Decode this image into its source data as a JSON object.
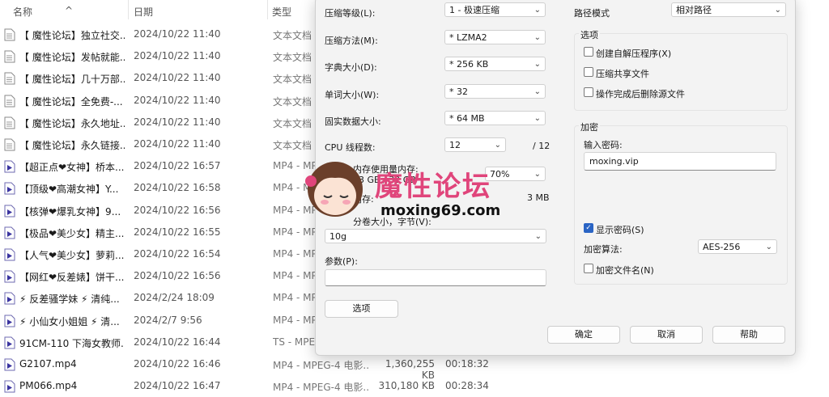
{
  "explorer": {
    "columns": {
      "name": "名称",
      "date": "日期",
      "type": "类型"
    },
    "rows": [
      {
        "icon": "text-file-icon",
        "name": "【 魔性论坛】独立社交...",
        "date": "2024/10/22 11:40",
        "type": "文本文档",
        "size": "",
        "duration": ""
      },
      {
        "icon": "text-file-icon",
        "name": "【 魔性论坛】发帖就能...",
        "date": "2024/10/22 11:40",
        "type": "文本文档",
        "size": "",
        "duration": ""
      },
      {
        "icon": "text-file-icon",
        "name": "【 魔性论坛】几十万部...",
        "date": "2024/10/22 11:40",
        "type": "文本文档",
        "size": "",
        "duration": ""
      },
      {
        "icon": "text-file-icon",
        "name": "【 魔性论坛】全免费-...",
        "date": "2024/10/22 11:40",
        "type": "文本文档",
        "size": "",
        "duration": ""
      },
      {
        "icon": "text-file-icon",
        "name": "【 魔性论坛】永久地址...",
        "date": "2024/10/22 11:40",
        "type": "文本文档",
        "size": "",
        "duration": ""
      },
      {
        "icon": "text-file-icon",
        "name": "【 魔性论坛】永久链接...",
        "date": "2024/10/22 11:40",
        "type": "文本文档",
        "size": "",
        "duration": ""
      },
      {
        "icon": "video-file-icon",
        "name": "【超正点❤女神】桥本...",
        "date": "2024/10/22 16:57",
        "type": "MP4 - MPEG",
        "size": "",
        "duration": ""
      },
      {
        "icon": "video-file-icon",
        "name": "【顶级❤高潮女神】Y...",
        "date": "2024/10/22 16:58",
        "type": "MP4 - MPEG",
        "size": "",
        "duration": ""
      },
      {
        "icon": "video-file-icon",
        "name": "【核弹❤爆乳女神】9...",
        "date": "2024/10/22 16:56",
        "type": "MP4 - MPEG",
        "size": "",
        "duration": ""
      },
      {
        "icon": "video-file-icon",
        "name": "【极品❤美少女】精主...",
        "date": "2024/10/22 16:55",
        "type": "MP4 - MPEG",
        "size": "",
        "duration": ""
      },
      {
        "icon": "video-file-icon",
        "name": "【人气❤美少女】萝莉...",
        "date": "2024/10/22 16:54",
        "type": "MP4 - MPEG",
        "size": "",
        "duration": ""
      },
      {
        "icon": "video-file-icon",
        "name": "【网红❤反差婊】饼干...",
        "date": "2024/10/22 16:56",
        "type": "MP4 - MPEG",
        "size": "",
        "duration": ""
      },
      {
        "icon": "video-file-icon",
        "name": "⚡ 反差骚学妹 ⚡ 清纯...",
        "date": "2024/2/24 18:09",
        "type": "MP4 - MPEG",
        "size": "",
        "duration": ""
      },
      {
        "icon": "video-file-icon",
        "name": "⚡ 小仙女小姐姐 ⚡ 清...",
        "date": "2024/2/7 9:56",
        "type": "MP4 - MPEG",
        "size": "",
        "duration": ""
      },
      {
        "icon": "video-file-icon",
        "name": "91CM-110 下海女教师...",
        "date": "2024/10/22 16:44",
        "type": "TS - MPEG",
        "size": "",
        "duration": ""
      },
      {
        "icon": "video-file-icon",
        "name": "G2107.mp4",
        "date": "2024/10/22 16:46",
        "type": "MP4 - MPEG-4 电影...",
        "size": "1,360,255 KB",
        "duration": "00:18:32"
      },
      {
        "icon": "video-file-icon",
        "name": "PM066.mp4",
        "date": "2024/10/22 16:47",
        "type": "MP4 - MPEG-4 电影...",
        "size": "310,180 KB",
        "duration": "00:28:34"
      }
    ]
  },
  "dialog": {
    "compression_level": {
      "label": "压缩等级(L):",
      "value": "1 - 极速压缩"
    },
    "compression_method": {
      "label": "压缩方法(M):",
      "value": "* LZMA2"
    },
    "dictionary_size": {
      "label": "字典大小(D):",
      "value": "* 256 KB"
    },
    "word_size": {
      "label": "单词大小(W):",
      "value": "* 32"
    },
    "solid_block_size": {
      "label": "固实数据大小:",
      "value": "* 64 MB"
    },
    "cpu_threads": {
      "label": "CPU 线程数:",
      "value": "12",
      "max": "/ 12"
    },
    "memory_usage": {
      "label_line1": "内存使用量内存:",
      "label_line2": "23 GB",
      "label_line3": "/ 32 GB",
      "value": "70%"
    },
    "decompress_memory": {
      "label": "内存:",
      "value": "3 MB"
    },
    "volume_size": {
      "label": "分卷大小，字节(V):",
      "value": "10g"
    },
    "parameters": {
      "label": "参数(P):",
      "value": ""
    },
    "options_button": "选项",
    "path_mode": {
      "label": "路径模式",
      "value": "相对路径"
    },
    "options_group": {
      "title": "选项",
      "create_sfx": "创建自解压程序(X)",
      "compress_shared": "压缩共享文件",
      "delete_after": "操作完成后删除源文件"
    },
    "encryption_group": {
      "title": "加密",
      "password_label": "输入密码:",
      "password_value": "moxing.vip",
      "show_password": "显示密码(S)",
      "method_label": "加密算法:",
      "method_value": "AES-256",
      "encrypt_names": "加密文件名(N)"
    },
    "ok": "确定",
    "cancel": "取消",
    "help": "帮助"
  },
  "watermark": {
    "title": "魔性论坛",
    "url": "moxing69.com"
  }
}
